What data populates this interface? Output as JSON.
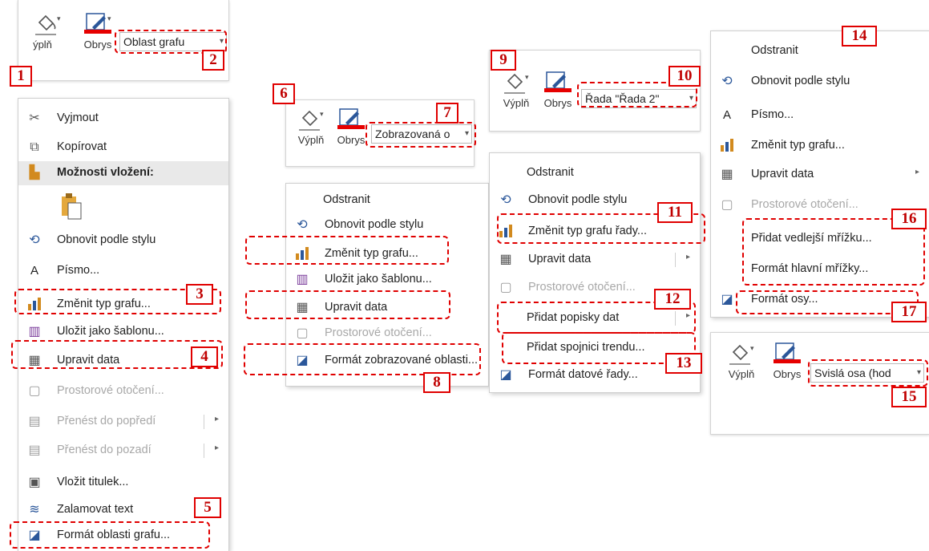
{
  "toolbar_common": {
    "fill_label": "Výplň",
    "outline_label": "Obrys",
    "fill_label_cut": "ýplň"
  },
  "panel1": {
    "combo": "Oblast grafu",
    "menu": [
      {
        "icon": "scissors-icon",
        "text": "Vyjmout"
      },
      {
        "icon": "copy-icon",
        "text": "Kopírovat"
      },
      {
        "icon": "paste-icon",
        "text": "Možnosti vložení:"
      },
      {
        "icon": "reset-style-icon",
        "text": "Obnovit podle stylu"
      },
      {
        "icon": "font-icon",
        "text": "Písmo..."
      },
      {
        "icon": "chart-type-icon",
        "text": "Změnit typ grafu..."
      },
      {
        "icon": "template-icon",
        "text": "Uložit jako šablonu..."
      },
      {
        "icon": "edit-data-icon",
        "text": "Upravit data"
      },
      {
        "icon": "rotation-icon",
        "text": "Prostorové otočení..."
      },
      {
        "icon": "bring-forward-icon",
        "text": "Přenést do popředí"
      },
      {
        "icon": "send-backward-icon",
        "text": "Přenést do pozadí"
      },
      {
        "icon": "insert-title-icon",
        "text": "Vložit titulek..."
      },
      {
        "icon": "wrap-text-icon",
        "text": "Zalamovat text"
      },
      {
        "icon": "format-icon",
        "text": "Formát oblasti grafu..."
      }
    ]
  },
  "panel2": {
    "combo": "Zobrazovaná o",
    "menu": [
      {
        "text": "Odstranit"
      },
      {
        "text": "Obnovit podle stylu"
      },
      {
        "text": "Změnit typ grafu..."
      },
      {
        "text": "Uložit jako šablonu..."
      },
      {
        "text": "Upravit data"
      },
      {
        "text": "Prostorové otočení..."
      },
      {
        "text": "Formát zobrazované oblasti..."
      }
    ]
  },
  "panel3": {
    "combo": "Řada \"Řada 2\"",
    "menu": [
      {
        "text": "Odstranit"
      },
      {
        "text": "Obnovit podle stylu"
      },
      {
        "text": "Změnit typ grafu řady..."
      },
      {
        "text": "Upravit data"
      },
      {
        "text": "Prostorové otočení..."
      },
      {
        "text": "Přidat popisky dat"
      },
      {
        "text": "Přidat spojnici trendu..."
      },
      {
        "text": "Formát datové řady..."
      }
    ]
  },
  "panel4": {
    "combo": "Svislá osa (hod",
    "menu": [
      {
        "text": "Odstranit"
      },
      {
        "text": "Obnovit podle stylu"
      },
      {
        "text": "Písmo..."
      },
      {
        "text": "Změnit typ grafu..."
      },
      {
        "text": "Upravit data"
      },
      {
        "text": "Prostorové otočení..."
      },
      {
        "text": "Přidat vedlejší mřížku..."
      },
      {
        "text": "Formát hlavní mřížky..."
      },
      {
        "text": "Formát osy..."
      }
    ]
  },
  "callouts": [
    "1",
    "2",
    "3",
    "4",
    "5",
    "6",
    "7",
    "8",
    "9",
    "10",
    "11",
    "12",
    "13",
    "14",
    "15",
    "16",
    "17"
  ],
  "colors": {
    "accent_red": "#e00000",
    "outline_red": "#e60000",
    "icon_blue": "#2b579a",
    "icon_orange": "#d28a1e"
  }
}
